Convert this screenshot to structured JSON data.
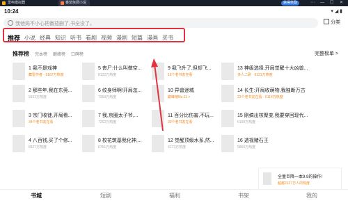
{
  "titlebar": {
    "app_name": "雷电模拟器",
    "doc_tab": "番茄免费小说",
    "badge": "获得奖励",
    "controls": [
      "⋯",
      "—",
      "☐",
      "✕"
    ]
  },
  "status": {
    "time": "10:24",
    "icons": "▾ ◢ ▮"
  },
  "search": {
    "placeholder": "我他妈不小心把番茄删了,书全没了。"
  },
  "category_label": "分类",
  "tabs": [
    "推荐",
    "小说",
    "经典",
    "知识",
    "听书",
    "看剧",
    "视频",
    "漫剧",
    "短篇",
    "漫画",
    "买书"
  ],
  "ranking": {
    "title": "推荐榜",
    "subtabs": [
      "完本榜",
      "巅峰榜",
      "口碑榜"
    ],
    "more": "完整榜单 >"
  },
  "books": [
    {
      "title": "1 我不是戏神",
      "meta": "藏雷作者 · 9187万热度",
      "orange": true
    },
    {
      "title": "2 那些年,我在东莞...",
      "meta": "9152万热度",
      "orange": false
    },
    {
      "title": "3 宗门收徒,开局看...",
      "meta": "34个老书友在看",
      "orange": true
    },
    {
      "title": "4 八百钱,买了个修...",
      "meta": "8327万热度",
      "orange": false
    },
    {
      "title": "5 丧尸:什么叫做空...",
      "meta": "8122万热度",
      "orange": false
    },
    {
      "title": "6 纹身师啊!开局怎...",
      "meta": "7359万热度",
      "orange": false
    },
    {
      "title": "7 我,京圈太子爷,...",
      "meta": "7262万热度",
      "orange": false
    },
    {
      "title": "8 校花筑基我化神,...",
      "meta": "6751万热度",
      "orange": false
    },
    {
      "title": "9 我飞升了,但却飞...",
      "meta": "16个老书友在看",
      "orange": true
    },
    {
      "title": "10 异兽迷城",
      "meta": "巅峰榜No.11 >",
      "orange": true
    },
    {
      "title": "11 百分比伤害,不玩...",
      "meta": "30个老书友在看",
      "orange": true
    },
    {
      "title": "12 觉醒顶级水系,然...",
      "meta": "6173万热度",
      "orange": false
    },
    {
      "title": "13 神级选择,开局觉醒十大凶兽...",
      "meta": "多人二刷 · 6121万热度",
      "orange": true
    },
    {
      "title": "14 长生:开局收萌物,我独断万古",
      "meta": "23个老书友在看 · 6114万热度",
      "orange": true
    },
    {
      "title": "15 刚搞出核聚变,我要穿回现代...",
      "meta": "6109万热度",
      "orange": false
    },
    {
      "title": "16 透视赌石王",
      "meta": "5860万热度",
      "orange": false
    }
  ],
  "promo": {
    "title": "全量巨降一本9.9的操作!",
    "sub": "超越2127万人的热度"
  },
  "bottomnav": [
    "书城",
    "短剧",
    "福利",
    "书架",
    "我的"
  ]
}
